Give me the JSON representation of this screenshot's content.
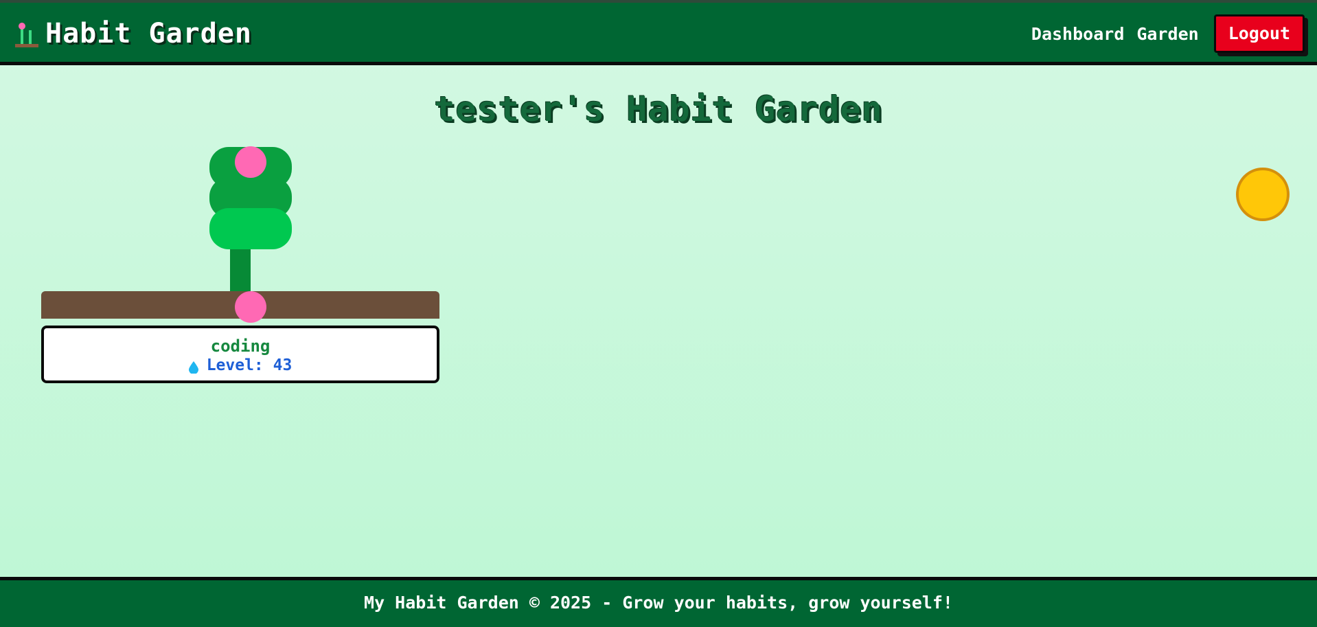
{
  "header": {
    "brand_title": "Habit Garden",
    "brand_icon": "sprout-icon",
    "nav": {
      "dashboard_label": "Dashboard",
      "garden_label": "Garden",
      "logout_label": "Logout"
    }
  },
  "main": {
    "title": "tester's Habit Garden",
    "plants": [
      {
        "name": "coding",
        "level_label": "Level: 43",
        "icon": "water-drop-icon"
      }
    ],
    "sun_icon": "sun-icon"
  },
  "footer": {
    "text": "My Habit Garden © 2025 - Grow your habits, grow yourself!"
  },
  "colors": {
    "header_bg": "#006633",
    "logout_bg": "#e8001c",
    "leaf_dark": "#0aa040",
    "leaf_light": "#00c850",
    "stem": "#078a36",
    "flower": "#ff69b4",
    "soil": "#6b4f3a",
    "sun": "#ffc708",
    "level_text": "#1e5fd6"
  }
}
